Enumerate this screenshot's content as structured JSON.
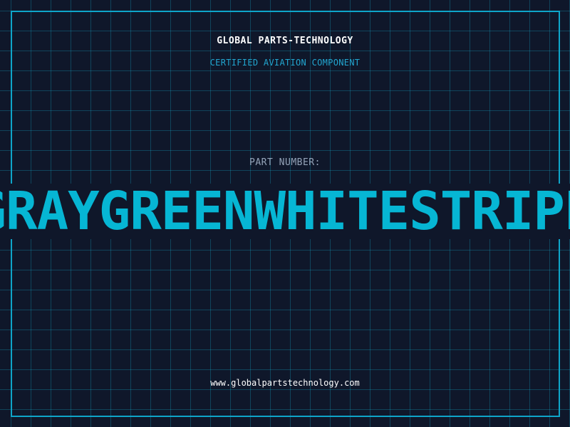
{
  "header": {
    "title": "GLOBAL PARTS-TECHNOLOGY",
    "subtitle": "CERTIFIED AVIATION COMPONENT"
  },
  "part": {
    "label": "PART NUMBER:",
    "number": "GRAYGREENWHITESTRIPE"
  },
  "footer": {
    "url": "www.globalpartstechnology.com"
  },
  "colors": {
    "background": "#0f172a",
    "grid": "#14b8dc",
    "accent": "#06b6d4",
    "label": "#94a3b8"
  }
}
